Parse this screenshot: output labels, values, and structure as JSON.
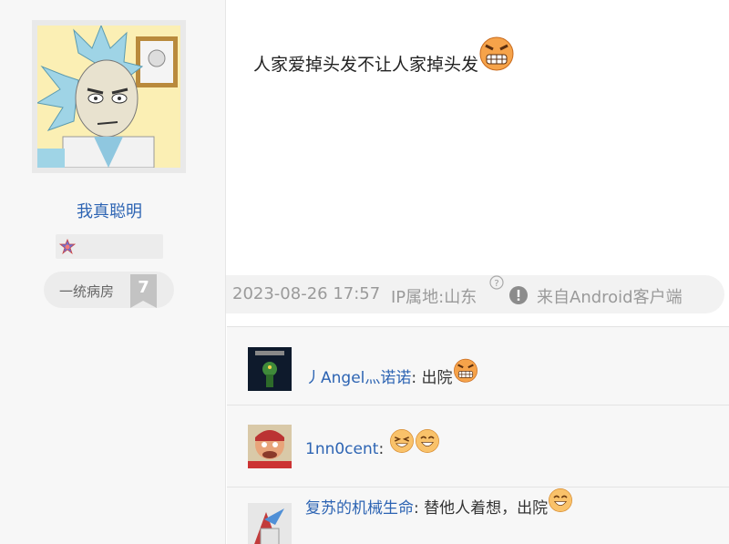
{
  "author": {
    "username": "我真聪明",
    "level_name": "一统病房",
    "level_number": "7"
  },
  "post": {
    "text": "人家爱掉头发不让人家掉头发",
    "emoji_icon": "grimace-emoji-icon",
    "date": "2023-08-26 17:57",
    "ip_location": "IP属地:山东",
    "source": "来自Android客户端"
  },
  "replies": [
    {
      "username": "丿Angel灬诺诺",
      "separator": ":",
      "text": " 出院",
      "emojis": [
        "grimace-emoji-icon"
      ]
    },
    {
      "username": "1nn0cent",
      "separator": ":",
      "text": "",
      "emojis": [
        "squint-laugh-emoji-icon",
        "smile-emoji-icon"
      ]
    },
    {
      "username": "复苏的机械生命",
      "separator": ":",
      "text": " 替他人着想，出院",
      "emojis": [
        "smile-emoji-icon"
      ]
    }
  ],
  "colors": {
    "link": "#2d64b3",
    "meta_text": "#9a9a9a",
    "sidebar_bg": "#f7f7f7",
    "level_badge": "#c3c3c3"
  }
}
